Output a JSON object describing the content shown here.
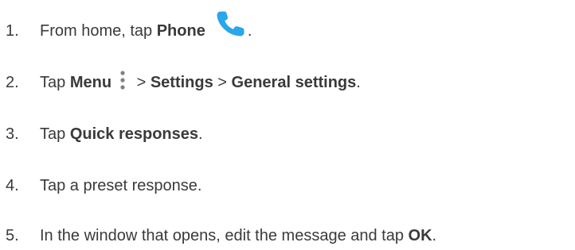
{
  "colors": {
    "text": "#3a3a3a",
    "phone_icon": "#2aa6ea",
    "menu_icon": "#808080"
  },
  "icons": {
    "phone": "phone-icon",
    "menu": "menu-icon"
  },
  "steps": [
    {
      "number": "1.",
      "text_before": "From home, tap ",
      "bold": "Phone",
      "text_after": "."
    },
    {
      "number": "2.",
      "text_before": "Tap ",
      "bold_menu": "Menu",
      "separator1": " > ",
      "bold_settings": "Settings",
      "separator2": " > ",
      "bold_general": "General settings",
      "text_after": "."
    },
    {
      "number": "3.",
      "text_before": "Tap ",
      "bold": "Quick responses",
      "text_after": "."
    },
    {
      "number": "4.",
      "text": "Tap a preset response."
    },
    {
      "number": "5.",
      "text_before": "In the window that opens, edit the message and tap ",
      "bold": "OK",
      "text_after": "."
    }
  ]
}
